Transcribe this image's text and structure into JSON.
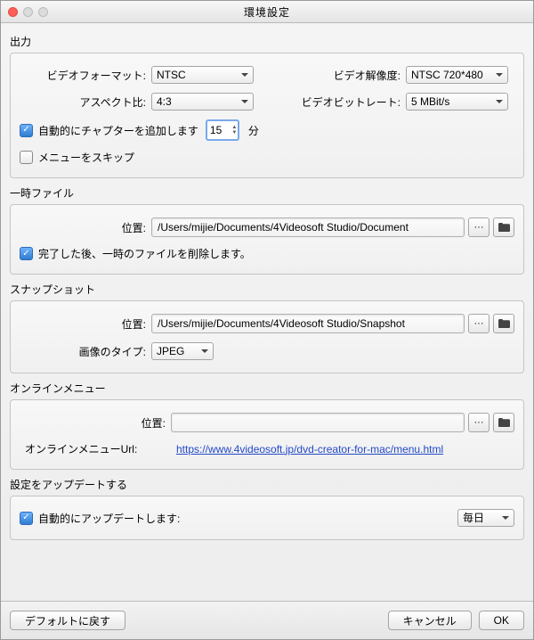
{
  "window": {
    "title": "環境設定"
  },
  "output": {
    "section": "出力",
    "videoFormatLabel": "ビデオフォーマット:",
    "videoFormatValue": "NTSC",
    "videoResLabel": "ビデオ解像度:",
    "videoResValue": "NTSC 720*480",
    "aspectLabel": "アスペクト比:",
    "aspectValue": "4:3",
    "bitrateLabel": "ビデオビットレート:",
    "bitrateValue": "5 MBit/s",
    "autoChapterLabel": "自動的にチャプターを追加します",
    "autoChapterValue": "15",
    "minutesLabel": "分",
    "skipMenuLabel": "メニューをスキップ"
  },
  "temp": {
    "section": "一時ファイル",
    "locationLabel": "位置:",
    "path": "/Users/mijie/Documents/4Videosoft Studio/Document",
    "deleteLabel": "完了した後、一時のファイルを削除します。"
  },
  "snapshot": {
    "section": "スナップショット",
    "locationLabel": "位置:",
    "path": "/Users/mijie/Documents/4Videosoft Studio/Snapshot",
    "typeLabel": "画像のタイプ:",
    "typeValue": "JPEG"
  },
  "online": {
    "section": "オンラインメニュー",
    "locationLabel": "位置:",
    "urlLabel": "オンラインメニューUrl:",
    "urlValue": "https://www.4videosoft.jp/dvd-creator-for-mac/menu.html"
  },
  "update": {
    "section": "設定をアップデートする",
    "autoLabel": "自動的にアップデートします:",
    "intervalValue": "毎日"
  },
  "footer": {
    "defaults": "デフォルトに戻す",
    "cancel": "キャンセル",
    "ok": "OK"
  },
  "icons": {
    "more": "more-icon",
    "folder": "folder-icon"
  }
}
